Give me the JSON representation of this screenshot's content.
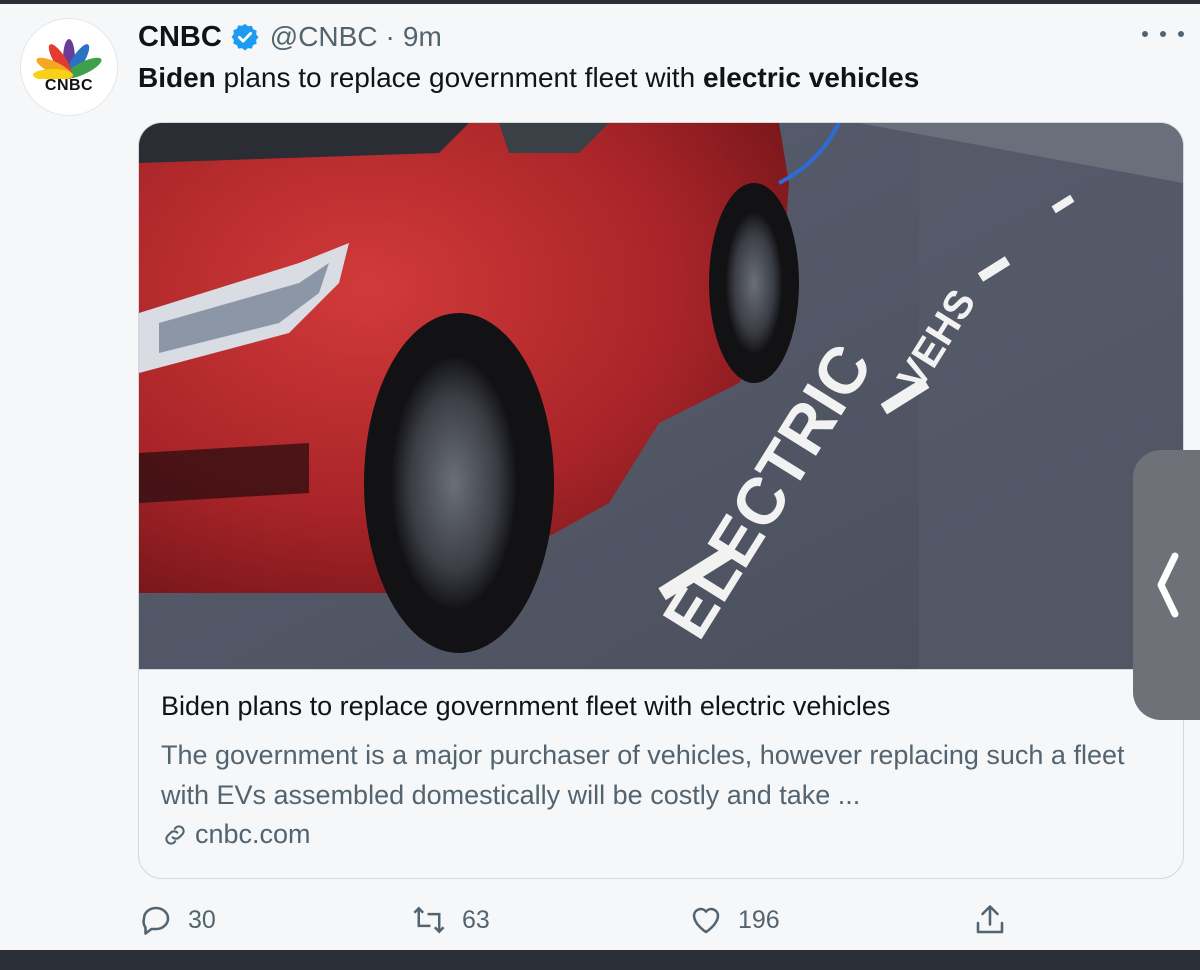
{
  "tweet": {
    "avatar_label": "CNBC",
    "name": "CNBC",
    "handle": "@CNBC",
    "separator": "·",
    "time": "9m",
    "text_parts": [
      "Biden",
      " plans to replace government fleet with ",
      "electric vehicles"
    ]
  },
  "card": {
    "image_road_text": [
      "ELECTRIC",
      "VEHS"
    ],
    "title": "Biden plans to replace government fleet with electric vehicles",
    "description": "The government is a major purchaser of vehicles, however replacing such a fleet with EVs assembled domestically will be costly and take ...",
    "domain": "cnbc.com"
  },
  "actions": {
    "reply_count": "30",
    "retweet_count": "63",
    "like_count": "196"
  },
  "icons": {
    "verified": "verified-badge-icon",
    "more": "more-dots-icon",
    "link": "link-icon",
    "reply": "reply-icon",
    "retweet": "retweet-icon",
    "like": "heart-icon",
    "share": "share-icon",
    "side_handle": "chevron-left-icon"
  },
  "colors": {
    "verified": "#1d9bf0",
    "secondary_text": "#536471",
    "car_red": "#b0262a",
    "road": "#4f5463",
    "handle_bg": "#6e7178"
  }
}
